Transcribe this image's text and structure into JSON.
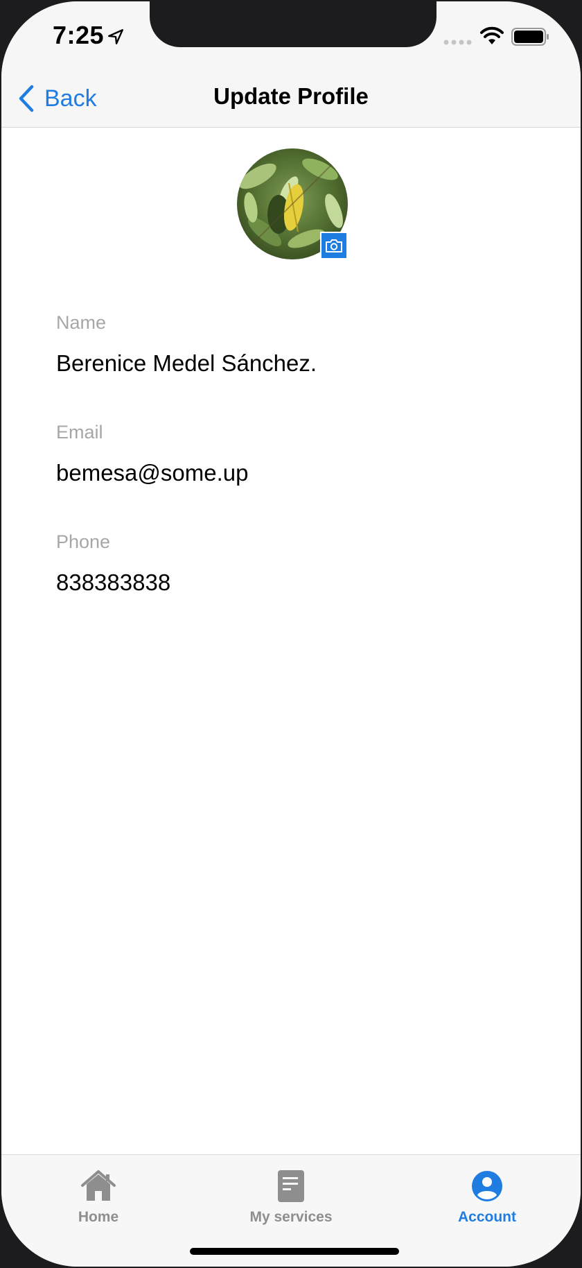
{
  "status_bar": {
    "time": "7:25"
  },
  "nav": {
    "back_label": "Back",
    "title": "Update Profile"
  },
  "profile": {
    "fields": [
      {
        "label": "Name",
        "value": "Berenice Medel Sánchez."
      },
      {
        "label": "Email",
        "value": "bemesa@some.up"
      },
      {
        "label": "Phone",
        "value": "838383838"
      }
    ]
  },
  "tabs": [
    {
      "label": "Home",
      "icon": "home-icon",
      "active": false
    },
    {
      "label": "My services",
      "icon": "document-icon",
      "active": false
    },
    {
      "label": "Account",
      "icon": "account-icon",
      "active": true
    }
  ],
  "colors": {
    "accent": "#1f7ce0",
    "inactive": "#8e8e8e",
    "label": "#a7a7a7"
  }
}
